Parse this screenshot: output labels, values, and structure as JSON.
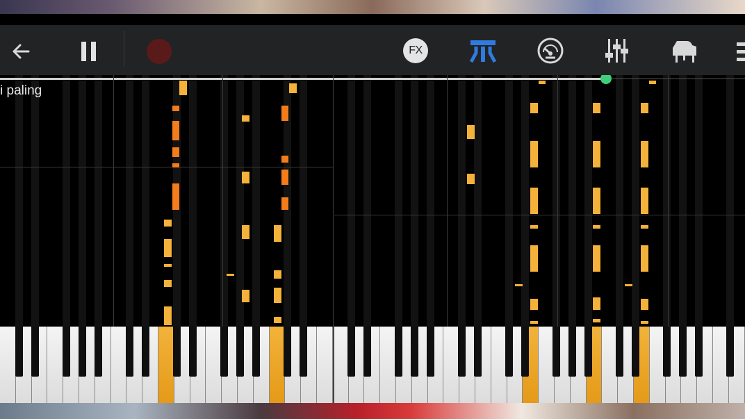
{
  "toolbar": {
    "back_icon": "arrow-left-icon",
    "pause_icon": "pause-icon",
    "record_icon": "record-icon",
    "fx_label": "FX",
    "sheet_icon": "piano-roll-icon",
    "speed_icon": "speedometer-icon",
    "mixer_icon": "mixer-sliders-icon",
    "piano_icon": "grand-piano-icon",
    "menu_icon": "menu-icon",
    "accent_color": "#2f7be0",
    "record_color": "#5b1a1a"
  },
  "player": {
    "song_title": "i paling",
    "progress_fraction": 0.813,
    "knob_color": "#3ecf7a",
    "note_colors": {
      "left_hand": "#f57c1a",
      "right_hand": "#f5b23a"
    }
  },
  "keyboard": {
    "active_key_color": "#e8a020"
  }
}
